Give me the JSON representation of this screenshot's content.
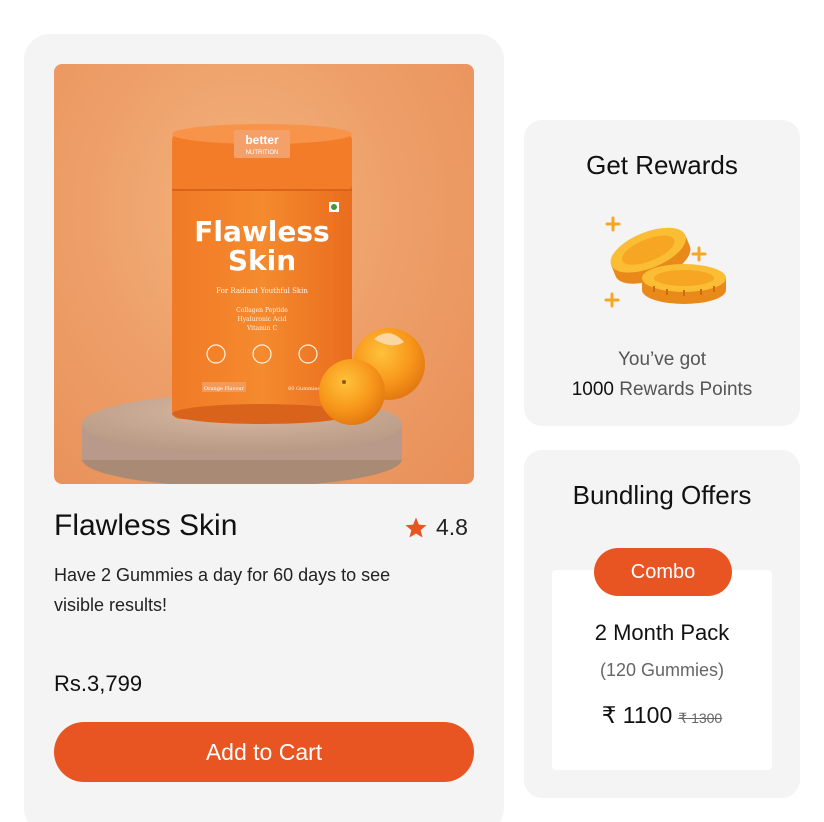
{
  "colors": {
    "accent": "#e85523",
    "card_bg": "#f4f4f4",
    "coin": "#f6a623",
    "star": "#e85523"
  },
  "product": {
    "title": "Flawless Skin",
    "rating": "4.8",
    "description": "Have 2 Gummies a day for 60 days to see visible results!",
    "price": "Rs.3,799",
    "add_to_cart_label": "Add to Cart",
    "image": {
      "brand_line1": "better",
      "brand_line2": "NUTRITION",
      "title_line1": "Flawless",
      "title_line2": "Skin",
      "tagline": "For Radiant Youthful Skin",
      "ingredients": [
        "Collagen Peptide",
        "Hyaluronic Acid",
        "Vitamin C"
      ],
      "flavour": "Orange Flavour",
      "count": "60 Gummies"
    }
  },
  "rewards": {
    "title": "Get Rewards",
    "icon": "coins-icon",
    "line1": "You’ve got",
    "points": "1000",
    "points_label": "Rewards Points"
  },
  "bundle": {
    "title": "Bundling Offers",
    "badge": "Combo",
    "pack_name": "2 Month Pack",
    "pack_count": "(120 Gummies)",
    "price": "₹ 1100",
    "old_price": "₹ 1300"
  }
}
